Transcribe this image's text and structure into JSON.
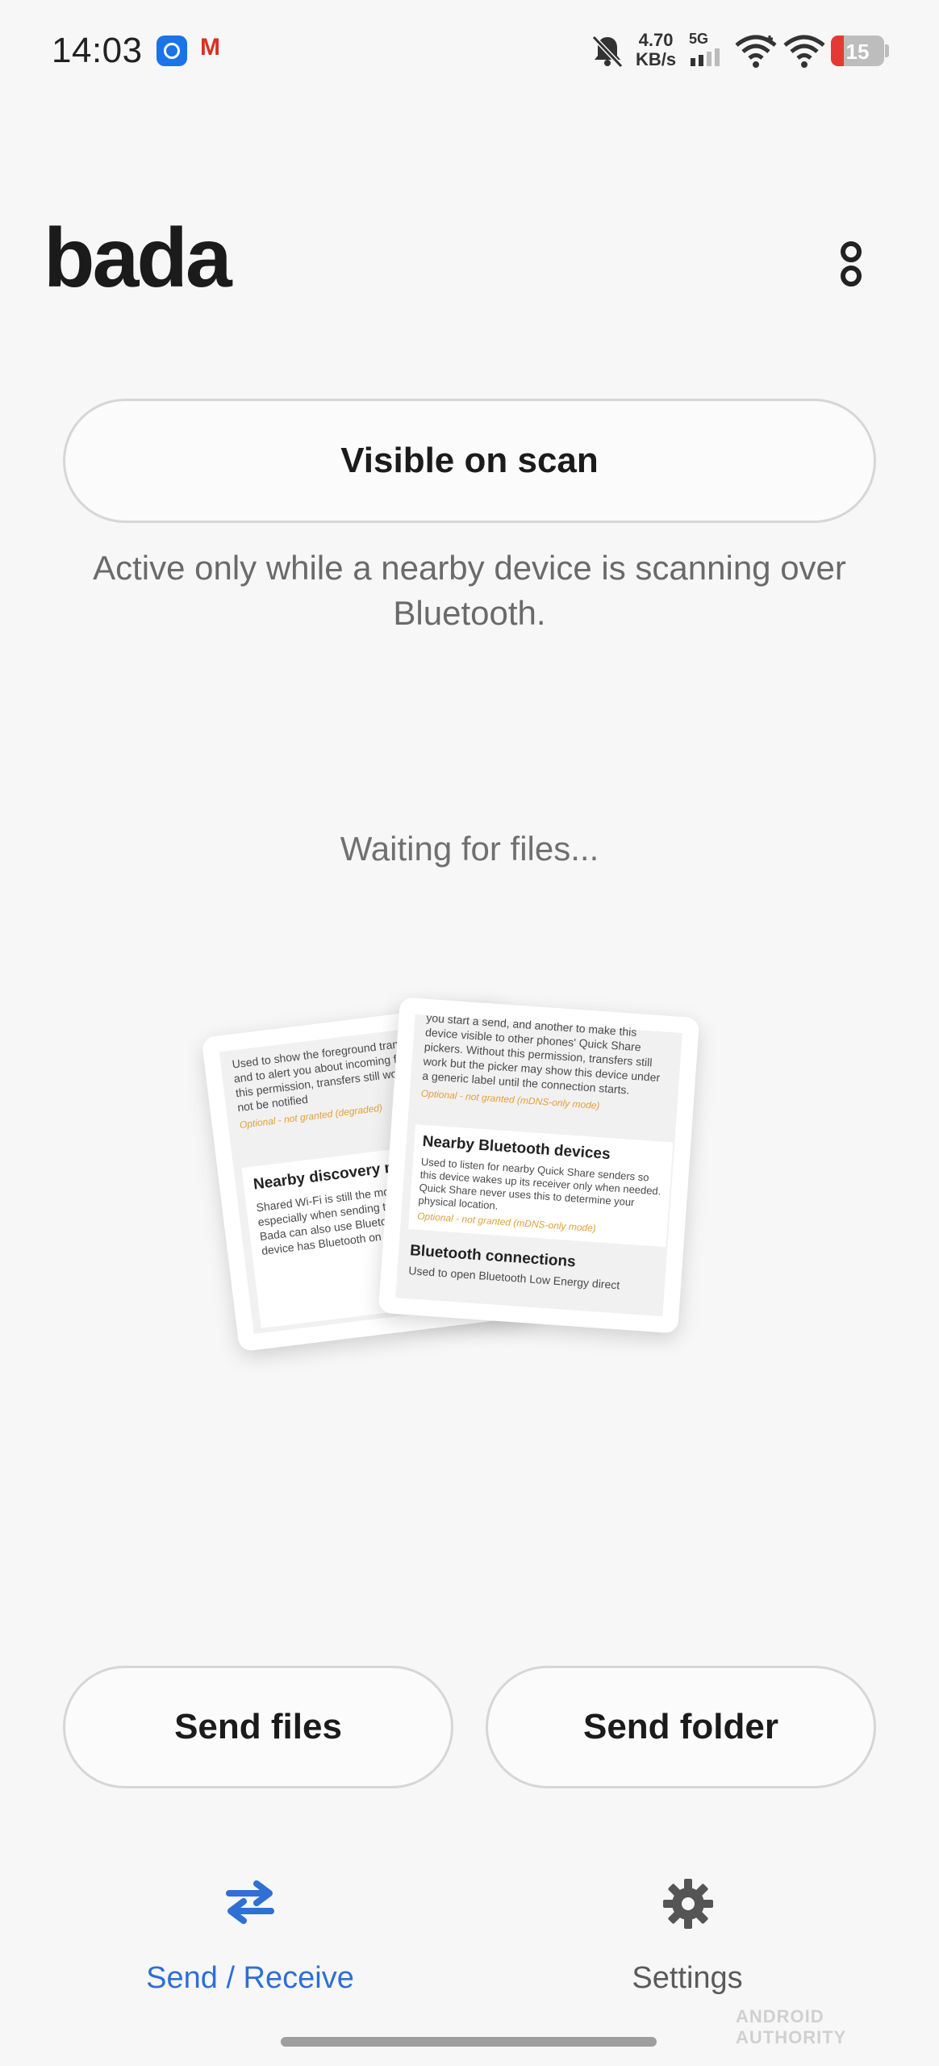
{
  "status_bar": {
    "time": "14:03",
    "data_rate_value": "4.70",
    "data_rate_unit": "KB/s",
    "network_type": "5G",
    "battery_level": "15",
    "gmail_letter": "M",
    "icons": [
      "app-notification-icon",
      "gmail-icon",
      "bell-muted-icon",
      "signal-icon",
      "wifi-icon",
      "wifi-icon",
      "battery-icon"
    ]
  },
  "header": {
    "title": "bada",
    "menu_icon": "overflow-menu-icon"
  },
  "visibility": {
    "button_label": "Visible on scan",
    "description": "Active only while a nearby device is scanning over Bluetooth."
  },
  "status_text": "Waiting for files...",
  "illustration": {
    "left_card": {
      "para1": "Used to show the foreground transfer indicator and to alert you about incoming files. Without this permission, transfers still work but you will not be notified",
      "optional1": "Optional - not granted (degraded)",
      "heading": "Nearby discovery requirements",
      "para2": "Shared Wi-Fi is still the most reliable path, especially when sending to a nearby peer. Bada can also use Bluetooth to bootstrap if the device has Bluetooth on for this"
    },
    "right_card": {
      "para1": "you start a send, and another to make this device visible to other phones' Quick Share pickers. Without this permission, transfers still work but the picker may show this device under a generic label until the connection starts.",
      "optional1": "Optional - not granted (mDNS-only mode)",
      "heading1": "Nearby Bluetooth devices",
      "para2": "Used to listen for nearby Quick Share senders so this device wakes up its receiver only when needed. Quick Share never uses this to determine your physical location.",
      "optional2": "Optional - not granted (mDNS-only mode)",
      "heading2": "Bluetooth connections",
      "para3": "Used to open Bluetooth Low Energy direct"
    }
  },
  "actions": {
    "send_files": "Send files",
    "send_folder": "Send folder"
  },
  "bottom_nav": {
    "items": [
      {
        "label": "Send / Receive",
        "icon": "swap-arrows-icon",
        "active": true,
        "color": "#2f6fd6"
      },
      {
        "label": "Settings",
        "icon": "gear-icon",
        "active": false,
        "color": "#5b5b5b"
      }
    ]
  },
  "watermark": "ANDROID AUTHORITY"
}
